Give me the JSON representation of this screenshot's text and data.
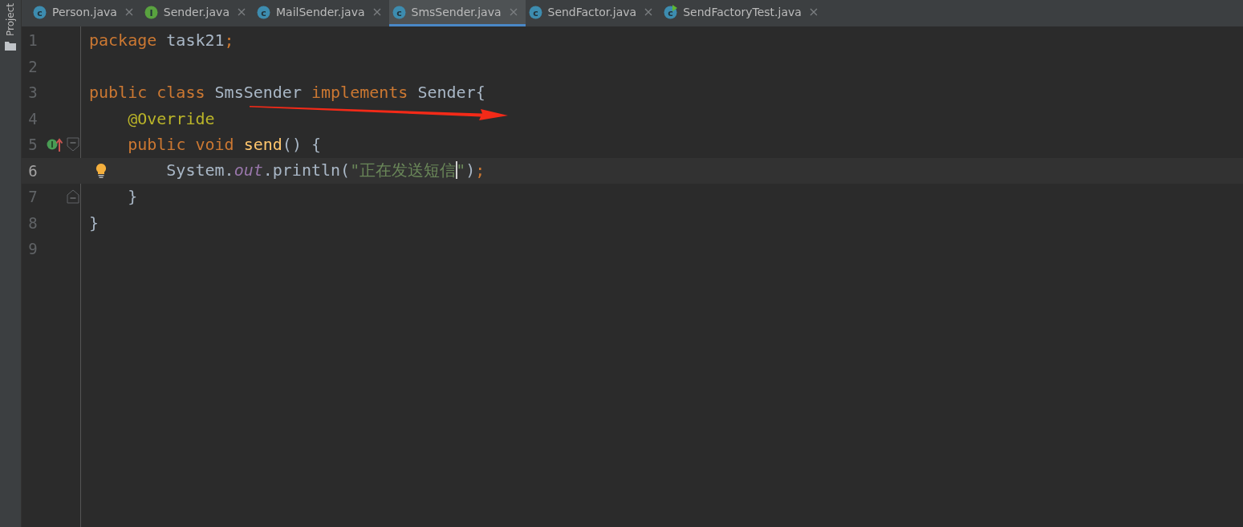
{
  "side_strip": {
    "label": "Project"
  },
  "tabs": [
    {
      "label": "Person.java",
      "icon": {
        "kind": "class",
        "letter": "c"
      },
      "selected": false
    },
    {
      "label": "Sender.java",
      "icon": {
        "kind": "interface",
        "letter": "I"
      },
      "selected": false
    },
    {
      "label": "MailSender.java",
      "icon": {
        "kind": "class",
        "letter": "c"
      },
      "selected": false
    },
    {
      "label": "SmsSender.java",
      "icon": {
        "kind": "class",
        "letter": "c"
      },
      "selected": true
    },
    {
      "label": "SendFactor.java",
      "icon": {
        "kind": "class",
        "letter": "c"
      },
      "selected": false
    },
    {
      "label": "SendFactoryTest.java",
      "icon": {
        "kind": "test",
        "letter": "c"
      },
      "selected": false
    }
  ],
  "lines": [
    {
      "number": "1",
      "current": false,
      "tokens": [
        {
          "kind": "keyword",
          "text": "package "
        },
        {
          "kind": "plain",
          "text": "task21"
        },
        {
          "kind": "keyword",
          "text": ";"
        }
      ]
    },
    {
      "number": "2",
      "current": false
    },
    {
      "number": "3",
      "current": false,
      "tokens": [
        {
          "kind": "keyword",
          "text": "public class "
        },
        {
          "kind": "plain",
          "text": "SmsSender "
        },
        {
          "kind": "keyword",
          "text": "implements "
        },
        {
          "kind": "plain",
          "text": "Sender{"
        }
      ]
    },
    {
      "number": "4",
      "current": false,
      "tokens": [
        {
          "kind": "annotation",
          "text": "    @Override"
        }
      ]
    },
    {
      "number": "5",
      "current": false,
      "gutter_icons": [
        {
          "kind": "implements"
        },
        {
          "kind": "fold_start"
        }
      ],
      "tokens": [
        {
          "kind": "keyword",
          "text": "    public void "
        },
        {
          "kind": "method",
          "text": "send"
        },
        {
          "kind": "plain",
          "text": "() {"
        }
      ]
    },
    {
      "number": "6",
      "current": true,
      "gutter_icons": [
        {
          "kind": "bulb"
        }
      ],
      "tokens": [
        {
          "kind": "plain",
          "text": "        System."
        },
        {
          "kind": "field",
          "text": "out"
        },
        {
          "kind": "plain",
          "text": ".println("
        },
        {
          "kind": "string",
          "text": "\"正在发送短信",
          "caret": true
        },
        {
          "kind": "string",
          "text": "\""
        },
        {
          "kind": "plain",
          "text": ")"
        },
        {
          "kind": "keyword",
          "text": ";"
        }
      ]
    },
    {
      "number": "7",
      "current": false,
      "gutter_icons": [
        {
          "kind": "fold_end"
        }
      ],
      "tokens": [
        {
          "kind": "plain",
          "text": "    }"
        }
      ]
    },
    {
      "number": "8",
      "current": false,
      "tokens": [
        {
          "kind": "plain",
          "text": "}"
        }
      ]
    },
    {
      "number": "9",
      "current": false
    }
  ]
}
